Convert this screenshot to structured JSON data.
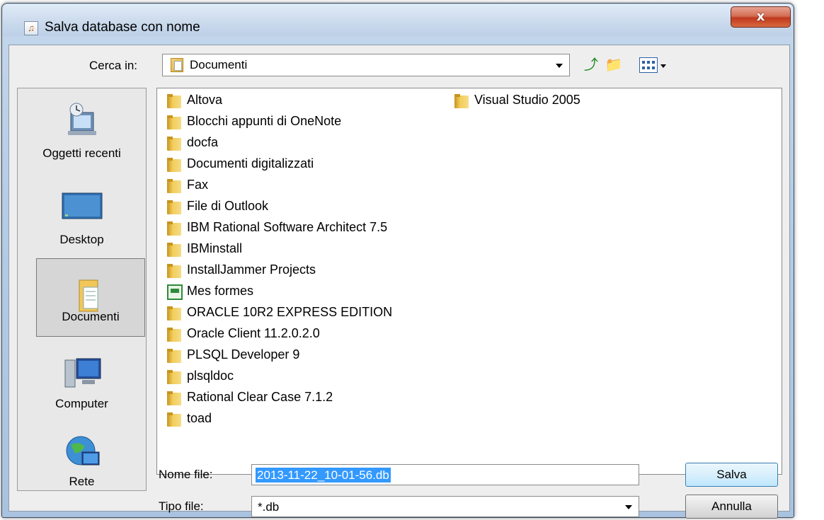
{
  "window": {
    "title": "Salva database con nome",
    "close_label": "x"
  },
  "toolbar": {
    "look_in_label": "Cerca in:",
    "look_in_value": "Documenti",
    "icons": [
      "up-one-level-icon",
      "new-folder-icon",
      "view-menu-icon"
    ]
  },
  "places": [
    {
      "label": "Oggetti recenti",
      "icon": "recent-items-icon"
    },
    {
      "label": "Desktop",
      "icon": "desktop-icon"
    },
    {
      "label": "Documenti",
      "icon": "documents-icon",
      "selected": true
    },
    {
      "label": "Computer",
      "icon": "computer-icon"
    },
    {
      "label": "Rete",
      "icon": "network-icon"
    }
  ],
  "files": [
    {
      "name": "Altova",
      "type": "folder"
    },
    {
      "name": "Blocchi appunti di OneNote",
      "type": "folder"
    },
    {
      "name": "docfa",
      "type": "folder"
    },
    {
      "name": "Documenti digitalizzati",
      "type": "folder"
    },
    {
      "name": "Fax",
      "type": "folder"
    },
    {
      "name": "File di Outlook",
      "type": "folder"
    },
    {
      "name": "IBM Rational Software Architect 7.5",
      "type": "folder"
    },
    {
      "name": "IBMinstall",
      "type": "folder"
    },
    {
      "name": "InstallJammer Projects",
      "type": "folder"
    },
    {
      "name": "Mes formes",
      "type": "special"
    },
    {
      "name": "ORACLE 10R2 EXPRESS EDITION",
      "type": "folder"
    },
    {
      "name": "Oracle Client 11.2.0.2.0",
      "type": "folder"
    },
    {
      "name": "PLSQL Developer 9",
      "type": "folder"
    },
    {
      "name": "plsqldoc",
      "type": "folder"
    },
    {
      "name": "Rational Clear Case 7.1.2",
      "type": "folder"
    },
    {
      "name": "toad",
      "type": "folder"
    },
    {
      "name": "Visual Studio 2005",
      "type": "folder"
    }
  ],
  "form": {
    "filename_label": "Nome file:",
    "filename_value": "2013-11-22_10-01-56.db",
    "filetype_label": "Tipo file:",
    "filetype_value": "*.db"
  },
  "buttons": {
    "save": "Salva",
    "cancel": "Annulla"
  }
}
